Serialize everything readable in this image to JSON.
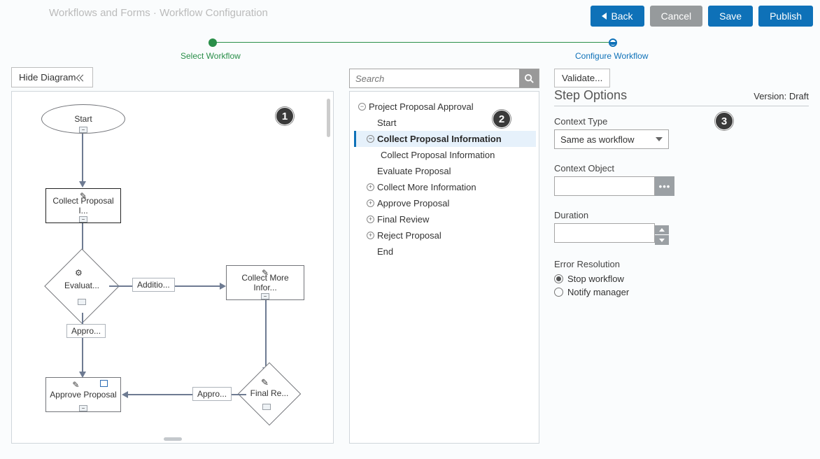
{
  "breadcrumb_ghost": "Workflows and Forms  ·  Workflow Configuration",
  "header": {
    "back": "Back",
    "cancel": "Cancel",
    "save": "Save",
    "publish": "Publish"
  },
  "stepper": {
    "step1": "Select Workflow",
    "step2": "Configure Workflow"
  },
  "hide_diagram": "Hide Diagram",
  "search_placeholder": "Search",
  "validate": "Validate...",
  "badges": {
    "b1": "1",
    "b2": "2",
    "b3": "3"
  },
  "tree": {
    "root": "Project Proposal Approval",
    "items": [
      {
        "label": "Start",
        "toggle": ""
      },
      {
        "label": "Collect Proposal Information",
        "toggle": "−",
        "selected": true
      },
      {
        "label": "Collect Proposal Information",
        "toggle": "",
        "child": true
      },
      {
        "label": "Evaluate Proposal",
        "toggle": ""
      },
      {
        "label": "Collect More Information",
        "toggle": "+"
      },
      {
        "label": "Approve Proposal",
        "toggle": "+"
      },
      {
        "label": "Final Review",
        "toggle": "+"
      },
      {
        "label": "Reject Proposal",
        "toggle": "+"
      },
      {
        "label": "End",
        "toggle": ""
      }
    ]
  },
  "options": {
    "section_title": "Step Options",
    "version": "Version: Draft",
    "context_type_label": "Context Type",
    "context_type_value": "Same as workflow",
    "context_object_label": "Context Object",
    "duration_label": "Duration",
    "error_label": "Error Resolution",
    "error_stop": "Stop workflow",
    "error_notify": "Notify manager"
  },
  "diagram": {
    "start": "Start",
    "collect": "Collect Proposal I...",
    "evaluate": "Evaluat...",
    "collect_more": "Collect More Infor...",
    "approve": "Approve Proposal",
    "final": "Final Re...",
    "edge_additio": "Additio...",
    "edge_appro1": "Appro...",
    "edge_appro2": "Appro..."
  }
}
